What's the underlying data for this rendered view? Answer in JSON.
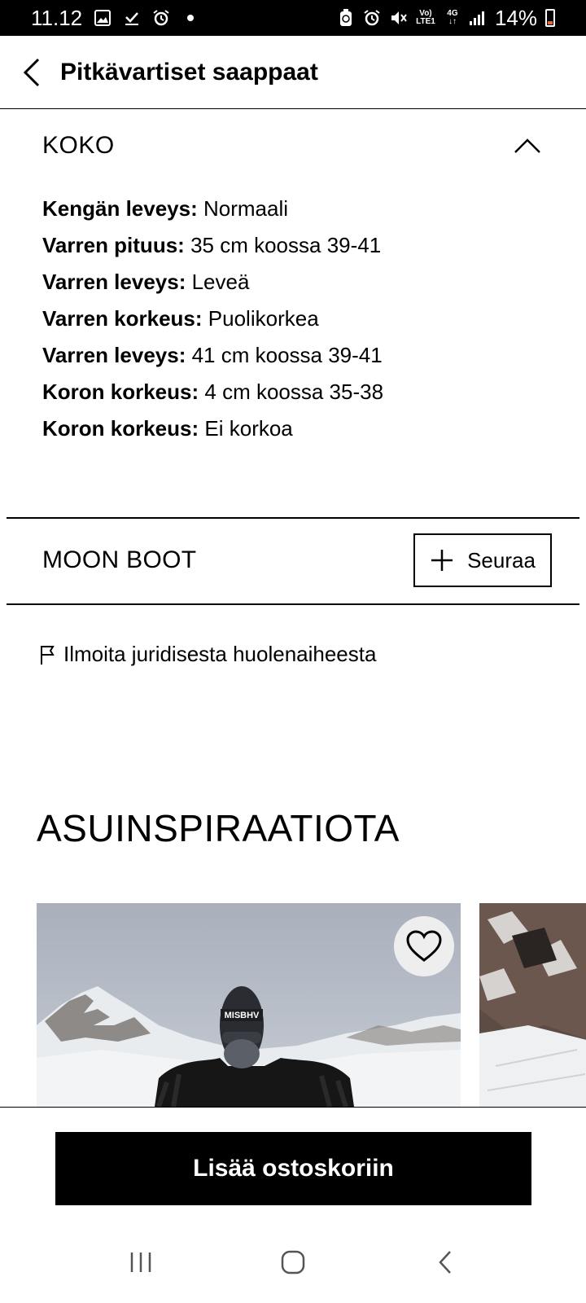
{
  "status_bar": {
    "time": "11.12",
    "network_top": "Vo)",
    "network_bottom": "LTE1",
    "signal_top": "4G",
    "signal_bottom": "↓↑",
    "battery": "14%",
    "battery_color": "#e8643b"
  },
  "header": {
    "title": "Pitkävartiset saappaat"
  },
  "size_section": {
    "title": "KOKO",
    "details": [
      {
        "label": "Kengän leveys:",
        "value": "Normaali"
      },
      {
        "label": "Varren pituus:",
        "value": "35 cm koossa 39-41"
      },
      {
        "label": "Varren leveys:",
        "value": "Leveä"
      },
      {
        "label": "Varren korkeus:",
        "value": "Puolikorkea"
      },
      {
        "label": "Varren leveys:",
        "value": "41 cm koossa 39-41"
      },
      {
        "label": "Koron korkeus:",
        "value": "4 cm koossa 35-38"
      },
      {
        "label": "Koron korkeus:",
        "value": "Ei korkoa"
      }
    ]
  },
  "brand": {
    "name": "MOON BOOT",
    "follow_label": "Seuraa"
  },
  "report": {
    "label": "Ilmoita juridisesta huolenaiheesta"
  },
  "inspiration": {
    "title": "ASUINSPIRAATIOTA",
    "balaclava_text": "MISBHV"
  },
  "cart": {
    "button_label": "Lisää ostoskoriin"
  },
  "colors": {
    "primary": "#000000",
    "background": "#ffffff"
  }
}
